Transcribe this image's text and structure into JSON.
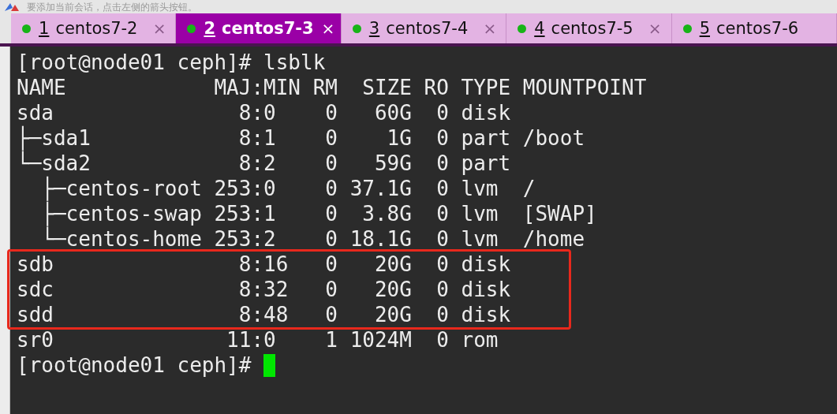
{
  "hint_bar": {
    "text": "要添加当前会话，点击左侧的箭头按钮。"
  },
  "tabs": [
    {
      "number": "1",
      "title": "centos7-2",
      "selected": false,
      "closable": true
    },
    {
      "number": "2",
      "title": "centos7-3",
      "selected": true,
      "closable": true
    },
    {
      "number": "3",
      "title": "centos7-4",
      "selected": false,
      "closable": true
    },
    {
      "number": "4",
      "title": "centos7-5",
      "selected": false,
      "closable": true
    },
    {
      "number": "5",
      "title": "centos7-6",
      "selected": false,
      "closable": false
    }
  ],
  "close_glyph": "×",
  "terminal": {
    "lines": [
      {
        "text": "[root@node01 ceph]# lsblk",
        "highlighted": false
      },
      {
        "text": "NAME            MAJ:MIN RM  SIZE RO TYPE MOUNTPOINT",
        "highlighted": false
      },
      {
        "text": "sda               8:0    0   60G  0 disk",
        "highlighted": false
      },
      {
        "text": "├─sda1            8:1    0    1G  0 part /boot",
        "highlighted": false
      },
      {
        "text": "└─sda2            8:2    0   59G  0 part",
        "highlighted": false
      },
      {
        "text": "  ├─centos-root 253:0    0 37.1G  0 lvm  /",
        "highlighted": false
      },
      {
        "text": "  ├─centos-swap 253:1    0  3.8G  0 lvm  [SWAP]",
        "highlighted": false
      },
      {
        "text": "  └─centos-home 253:2    0 18.1G  0 lvm  /home",
        "highlighted": false
      },
      {
        "text": "sdb               8:16   0   20G  0 disk",
        "highlighted": true
      },
      {
        "text": "sdc               8:32   0   20G  0 disk",
        "highlighted": true
      },
      {
        "text": "sdd               8:48   0   20G  0 disk",
        "highlighted": true
      },
      {
        "text": "sr0              11:0    1 1024M  0 rom",
        "highlighted": false
      },
      {
        "text": "[root@node01 ceph]# ",
        "highlighted": false,
        "cursor": true
      }
    ]
  }
}
